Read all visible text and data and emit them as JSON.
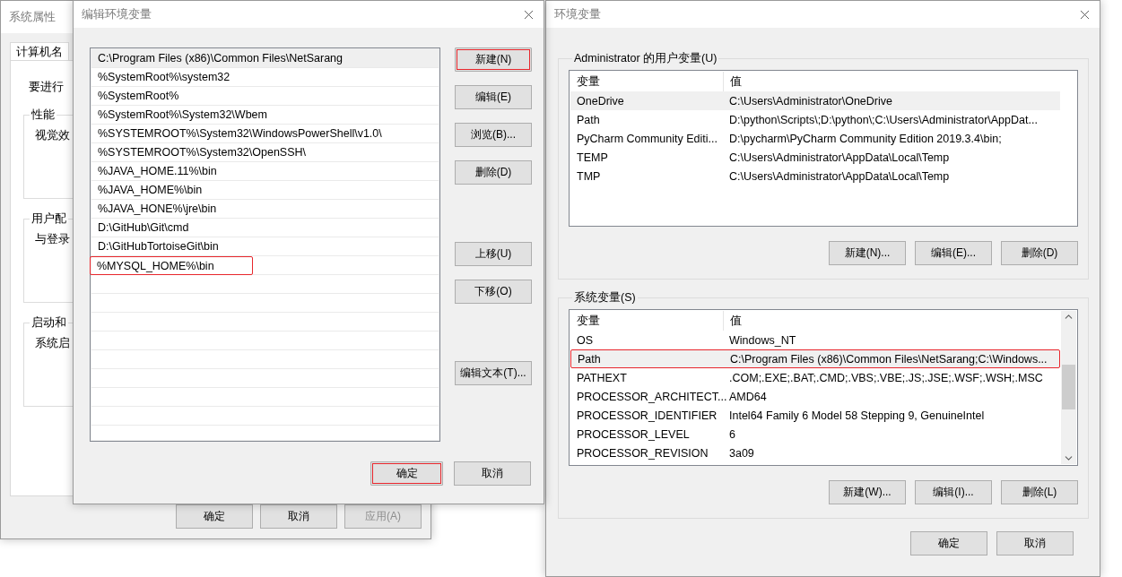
{
  "system_properties": {
    "title": "系统属性",
    "tabs": [
      {
        "label": "计算机名",
        "selected": true
      }
    ],
    "intro": "要进行",
    "groups": [
      {
        "title": "性能",
        "text": "视觉效"
      },
      {
        "title": "用户配",
        "text": "与登录"
      },
      {
        "title": "启动和",
        "text": "系统启"
      }
    ],
    "buttons": [
      {
        "label": "确定",
        "disabled": false
      },
      {
        "label": "取消",
        "disabled": false
      },
      {
        "label": "应用(A)",
        "disabled": true
      }
    ]
  },
  "edit_dialog": {
    "title": "编辑环境变量",
    "entries": [
      {
        "text": "C:\\Program Files (x86)\\Common Files\\NetSarang",
        "selected": true,
        "highlighted": false
      },
      {
        "text": "%SystemRoot%\\system32",
        "selected": false,
        "highlighted": false
      },
      {
        "text": "%SystemRoot%",
        "selected": false,
        "highlighted": false
      },
      {
        "text": "%SystemRoot%\\System32\\Wbem",
        "selected": false,
        "highlighted": false
      },
      {
        "text": "%SYSTEMROOT%\\System32\\WindowsPowerShell\\v1.0\\",
        "selected": false,
        "highlighted": false
      },
      {
        "text": "%SYSTEMROOT%\\System32\\OpenSSH\\",
        "selected": false,
        "highlighted": false
      },
      {
        "text": "%JAVA_HOME.11%\\bin",
        "selected": false,
        "highlighted": false
      },
      {
        "text": "%JAVA_HOME%\\bin",
        "selected": false,
        "highlighted": false
      },
      {
        "text": "%JAVA_HONE%\\jre\\bin",
        "selected": false,
        "highlighted": false
      },
      {
        "text": "D:\\GitHub\\Git\\cmd",
        "selected": false,
        "highlighted": false
      },
      {
        "text": "D:\\GitHubTortoiseGit\\bin",
        "selected": false,
        "highlighted": false
      },
      {
        "text": "%MYSQL_HOME%\\bin",
        "selected": false,
        "highlighted": true
      }
    ],
    "side_button_groups": [
      [
        {
          "label": "新建(N)",
          "highlighted": true
        },
        {
          "label": "编辑(E)",
          "highlighted": false
        },
        {
          "label": "浏览(B)...",
          "highlighted": false
        },
        {
          "label": "删除(D)",
          "highlighted": false
        }
      ],
      [
        {
          "label": "上移(U)",
          "highlighted": false
        },
        {
          "label": "下移(O)",
          "highlighted": false
        }
      ],
      [
        {
          "label": "编辑文本(T)...",
          "highlighted": false
        }
      ]
    ],
    "buttons": [
      {
        "label": "确定",
        "highlighted": true
      },
      {
        "label": "取消",
        "highlighted": false
      }
    ]
  },
  "env_dialog": {
    "title": "环境变量",
    "user_vars": {
      "title": "Administrator 的用户变量(U)",
      "columns": [
        "变量",
        "值"
      ],
      "rows": [
        {
          "name": "OneDrive",
          "value": "C:\\Users\\Administrator\\OneDrive",
          "selected": true,
          "highlighted": false
        },
        {
          "name": "Path",
          "value": "D:\\python\\Scripts\\;D:\\python\\;C:\\Users\\Administrator\\AppDat...",
          "selected": false,
          "highlighted": false
        },
        {
          "name": "PyCharm Community Editi...",
          "value": "D:\\pycharm\\PyCharm Community Edition 2019.3.4\\bin;",
          "selected": false,
          "highlighted": false
        },
        {
          "name": "TEMP",
          "value": "C:\\Users\\Administrator\\AppData\\Local\\Temp",
          "selected": false,
          "highlighted": false
        },
        {
          "name": "TMP",
          "value": "C:\\Users\\Administrator\\AppData\\Local\\Temp",
          "selected": false,
          "highlighted": false
        }
      ],
      "scrollbar": false,
      "buttons": [
        "新建(N)...",
        "编辑(E)...",
        "删除(D)"
      ]
    },
    "system_vars": {
      "title": "系统变量(S)",
      "columns": [
        "变量",
        "值"
      ],
      "rows": [
        {
          "name": "OS",
          "value": "Windows_NT",
          "selected": false,
          "highlighted": false
        },
        {
          "name": "Path",
          "value": "C:\\Program Files (x86)\\Common Files\\NetSarang;C:\\Windows...",
          "selected": true,
          "highlighted": true
        },
        {
          "name": "PATHEXT",
          "value": ".COM;.EXE;.BAT;.CMD;.VBS;.VBE;.JS;.JSE;.WSF;.WSH;.MSC",
          "selected": false,
          "highlighted": false
        },
        {
          "name": "PROCESSOR_ARCHITECT...",
          "value": "AMD64",
          "selected": false,
          "highlighted": false
        },
        {
          "name": "PROCESSOR_IDENTIFIER",
          "value": "Intel64 Family 6 Model 58 Stepping 9, GenuineIntel",
          "selected": false,
          "highlighted": false
        },
        {
          "name": "PROCESSOR_LEVEL",
          "value": "6",
          "selected": false,
          "highlighted": false
        },
        {
          "name": "PROCESSOR_REVISION",
          "value": "3a09",
          "selected": false,
          "highlighted": false
        }
      ],
      "scrollbar": true,
      "buttons": [
        "新建(W)...",
        "编辑(I)...",
        "删除(L)"
      ]
    },
    "buttons": [
      "确定",
      "取消"
    ]
  }
}
